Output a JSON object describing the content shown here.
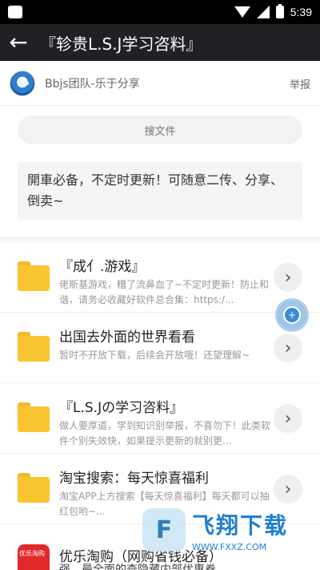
{
  "status_bar": {
    "time": "5:39"
  },
  "app_bar": {
    "title": "『轸贵L.S.J学习咨料』"
  },
  "group": {
    "name": "Bbjs团队-乐于分享",
    "report_label": "举报"
  },
  "search": {
    "placeholder": "搜文件"
  },
  "description": "開車必备，不定时更新！可随意二传、分享、倒卖~",
  "files": [
    {
      "title": "『成亻.游戏』",
      "desc": "佬斯基游戏，糟了流鼻血了~不定时更新！防止和谐，请务必收藏好软件总合集：https:/..."
    },
    {
      "title": "出国去外面的世界看看",
      "desc": "暂时不开放下载，后续会开放哦！还望理解~"
    },
    {
      "title": "『L.S.Jの学习咨料』",
      "desc": "做人要厚道，学到知识别举报，不喜勿下！此类软件个别失效快，如果提示更新的就别更..."
    },
    {
      "title": "淘宝搜索：每天惊喜福利",
      "desc": "淘宝APP上方搜索【每天惊喜福利】每天都可以抽红包哟~..."
    }
  ],
  "last_item": {
    "icon_label": "优乐淘购",
    "title": "优乐淘购（网购省钱必备）",
    "desc": "强、最全面的查隐藏内部优惠券"
  },
  "watermark": {
    "title": "飞翔下载",
    "url": "WWW.FXXZ.COM"
  },
  "icons": {
    "back": "arrow-left",
    "go": "chevron-right",
    "folder": "folder"
  },
  "colors": {
    "app_bar": "#1f2124",
    "folder": "#fbc531",
    "accent_blue": "#3a8ad8"
  }
}
